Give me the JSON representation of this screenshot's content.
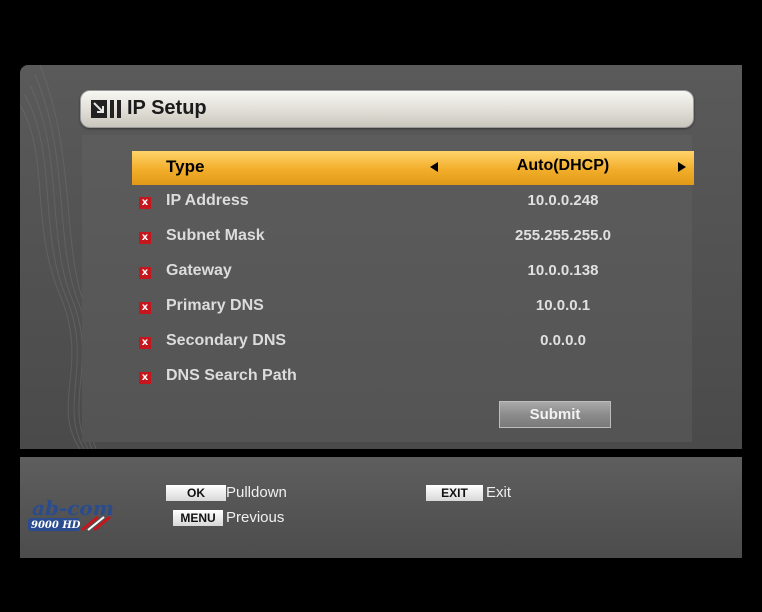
{
  "title": "IP Setup",
  "rows": [
    {
      "label": "Type",
      "value": "Auto(DHCP)"
    },
    {
      "label": "IP Address",
      "value": "10.0.0.248"
    },
    {
      "label": "Subnet Mask",
      "value": "255.255.255.0"
    },
    {
      "label": "Gateway",
      "value": "10.0.0.138"
    },
    {
      "label": "Primary DNS",
      "value": "10.0.0.1"
    },
    {
      "label": "Secondary DNS",
      "value": "0.0.0.0"
    },
    {
      "label": "DNS Search Path",
      "value": ""
    }
  ],
  "disabled_mark": "x",
  "submit_label": "Submit",
  "footer": {
    "ok_key": "OK",
    "ok_text": "Pulldown",
    "menu_key": "MENU",
    "menu_text": "Previous",
    "exit_key": "EXIT",
    "exit_text": "Exit"
  },
  "logo": {
    "brand": "ab-com",
    "model": "9000 HD"
  },
  "colors": {
    "selected_row": "#f2ae2a",
    "disabled_icon": "#c4161c",
    "panel": "#555555"
  }
}
